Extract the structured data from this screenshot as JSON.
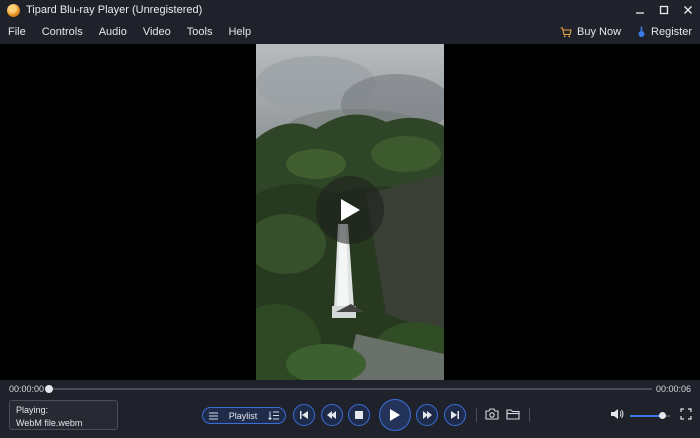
{
  "window": {
    "title": "Tipard Blu-ray Player (Unregistered)",
    "minimize_icon": "minimize-icon",
    "maximize_icon": "maximize-icon",
    "close_icon": "close-icon"
  },
  "menu": {
    "items": [
      "File",
      "Controls",
      "Audio",
      "Video",
      "Tools",
      "Help"
    ],
    "buy_now": "Buy Now",
    "register": "Register"
  },
  "player": {
    "current_time": "00:00:00",
    "total_time": "00:00:06",
    "progress": 0,
    "volume": 0.8
  },
  "now_playing": {
    "label": "Playing:",
    "file": "WebM file.webm"
  },
  "playlist": {
    "label": "Playlist"
  },
  "colors": {
    "accent": "#3b6fd6",
    "bar_bg": "#1f222a"
  }
}
